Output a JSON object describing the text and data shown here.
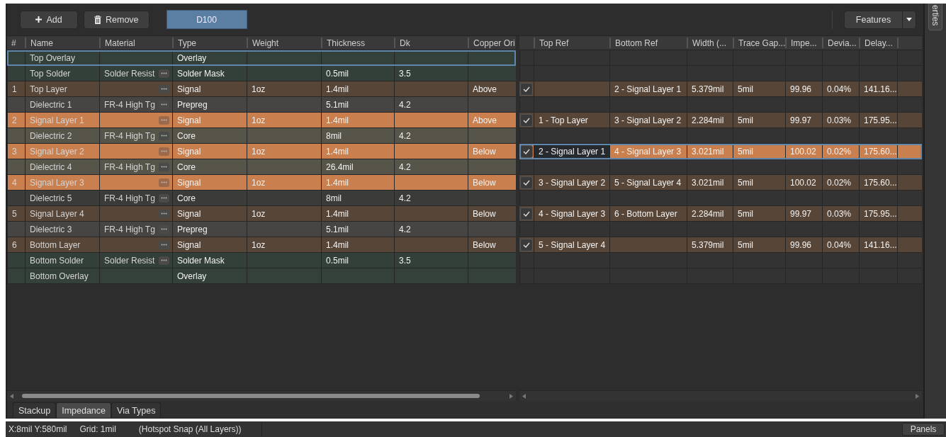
{
  "toolbar": {
    "buttons": [
      {
        "label": "Add"
      },
      {
        "label": "Remove"
      }
    ],
    "stack_name": "D100",
    "features_button": "Features"
  },
  "side_tab": "erties",
  "stackup": {
    "columns": [
      "#",
      "Name",
      "Material",
      "Type",
      "Weight",
      "Thickness",
      "Dk",
      "Copper Ori"
    ],
    "rows": [
      {
        "kind": "overlay",
        "name": "Top Overlay",
        "picker": false,
        "type": "Overlay",
        "selected": false,
        "focused": true
      },
      {
        "kind": "mask",
        "name": "Top Solder",
        "material": "Solder Resist",
        "picker": true,
        "type": "Solder Mask",
        "thickness": "0.5mil",
        "dk": "3.5",
        "selected": false,
        "focused": false
      },
      {
        "kind": "signal",
        "number": "1",
        "name": "Top Layer",
        "picker": true,
        "type": "Signal",
        "weight": "1oz",
        "thickness": "1.4mil",
        "orientation": "Above",
        "selected": false,
        "focused": false
      },
      {
        "kind": "prepreg",
        "name": "Dielectric 1",
        "material": "FR-4 High Tg",
        "picker": true,
        "type": "Prepreg",
        "thickness": "5.1mil",
        "dk": "4.2",
        "selected": false,
        "focused": false
      },
      {
        "number": "2",
        "name": "Signal Layer 1",
        "picker": true,
        "type": "Signal",
        "weight": "1oz",
        "thickness": "1.4mil",
        "orientation": "Above",
        "selected": true,
        "focused": false
      },
      {
        "kind": "core",
        "name": "Dielectric 2",
        "material": "FR-4 High Tg",
        "picker": true,
        "type": "Core",
        "thickness": "8mil",
        "dk": "4.2",
        "selected": false,
        "focused": false
      },
      {
        "number": "3",
        "name": "Signal Layer 2",
        "picker": true,
        "type": "Signal",
        "weight": "1oz",
        "thickness": "1.4mil",
        "orientation": "Below",
        "selected": true,
        "focused": false
      },
      {
        "kind": "core",
        "name": "Dielectric 4",
        "material": "FR-4 High Tg",
        "picker": true,
        "type": "Core",
        "thickness": "26.4mil",
        "dk": "4.2",
        "selected": false,
        "focused": false
      },
      {
        "number": "4",
        "name": "Signal Layer 3",
        "picker": true,
        "type": "Signal",
        "weight": "1oz",
        "thickness": "1.4mil",
        "orientation": "Below",
        "selected": true,
        "focused": false
      },
      {
        "kind": "core-dark",
        "name": "Dielectric 5",
        "material": "FR-4 High Tg",
        "picker": true,
        "type": "Core",
        "thickness": "8mil",
        "dk": "4.2",
        "selected": false,
        "focused": false
      },
      {
        "kind": "signal",
        "number": "5",
        "name": "Signal Layer 4",
        "picker": true,
        "type": "Signal",
        "weight": "1oz",
        "thickness": "1.4mil",
        "orientation": "Below",
        "selected": false,
        "focused": false
      },
      {
        "kind": "prepreg",
        "name": "Dielectric 3",
        "material": "FR-4 High Tg",
        "picker": true,
        "type": "Prepreg",
        "thickness": "5.1mil",
        "dk": "4.2",
        "selected": false,
        "focused": false
      },
      {
        "kind": "signal",
        "number": "6",
        "name": "Bottom Layer",
        "picker": true,
        "type": "Signal",
        "weight": "1oz",
        "thickness": "1.4mil",
        "orientation": "Below",
        "selected": false,
        "focused": false
      },
      {
        "kind": "mask",
        "name": "Bottom Solder",
        "material": "Solder Resist",
        "picker": true,
        "type": "Solder Mask",
        "thickness": "0.5mil",
        "dk": "3.5",
        "selected": false,
        "focused": false
      },
      {
        "kind": "overlay",
        "name": "Bottom Overlay",
        "picker": false,
        "type": "Overlay",
        "selected": false,
        "focused": false
      }
    ]
  },
  "impedance": {
    "columns": [
      "Top Ref",
      "Bottom Ref",
      "Width (...",
      "Trace Gap...",
      "Impe...",
      "Devia...",
      "Delay..."
    ],
    "rows": [
      {
        "kind": "blank"
      },
      {
        "kind": "blank"
      },
      {
        "kind": "pair",
        "checked": true,
        "selected": false,
        "editing": false,
        "bottom_ref": "2 - Signal Layer 1",
        "width": "5.379mil",
        "gap": "5mil",
        "impedance": "99.96",
        "deviation": "0.04%",
        "delay": "141.16..."
      },
      {
        "kind": "blank"
      },
      {
        "kind": "pair",
        "checked": true,
        "selected": false,
        "editing": false,
        "top_ref": "1 - Top Layer",
        "bottom_ref": "3 - Signal Layer 2",
        "width": "2.284mil",
        "gap": "5mil",
        "impedance": "99.97",
        "deviation": "0.03%",
        "delay": "175.95..."
      },
      {
        "kind": "blank"
      },
      {
        "kind": "pair",
        "checked": true,
        "selected": true,
        "editing": true,
        "top_ref": "2 - Signal Layer 1",
        "bottom_ref": "4 - Signal Layer 3",
        "width": "3.021mil",
        "gap": "5mil",
        "impedance": "100.02",
        "deviation": "0.02%",
        "delay": "175.60..."
      },
      {
        "kind": "blank"
      },
      {
        "kind": "pair",
        "checked": true,
        "selected": false,
        "editing": false,
        "top_ref": "3 - Signal Layer 2",
        "bottom_ref": "5 - Signal Layer 4",
        "width": "3.021mil",
        "gap": "5mil",
        "impedance": "100.02",
        "deviation": "0.02%",
        "delay": "175.60..."
      },
      {
        "kind": "blank"
      },
      {
        "kind": "pair",
        "checked": true,
        "selected": false,
        "editing": false,
        "top_ref": "4 - Signal Layer 3",
        "bottom_ref": "6 - Bottom Layer",
        "width": "2.284mil",
        "gap": "5mil",
        "impedance": "99.97",
        "deviation": "0.03%",
        "delay": "175.95..."
      },
      {
        "kind": "blank"
      },
      {
        "kind": "pair",
        "checked": true,
        "selected": false,
        "editing": false,
        "top_ref": "5 - Signal Layer 4",
        "width": "5.379mil",
        "gap": "5mil",
        "impedance": "99.96",
        "deviation": "0.04%",
        "delay": "141.16..."
      },
      {
        "kind": "blank"
      },
      {
        "kind": "blank"
      }
    ]
  },
  "tabs": [
    {
      "label": "Stackup",
      "selected": false
    },
    {
      "label": "Impedance",
      "selected": true
    },
    {
      "label": "Via Types",
      "selected": false
    }
  ],
  "status_bar": {
    "coords": "X:8mil Y:580mil",
    "grid": "Grid: 1mil",
    "snap": "(Hotspot Snap (All Layers))",
    "panels_button": "Panels"
  }
}
